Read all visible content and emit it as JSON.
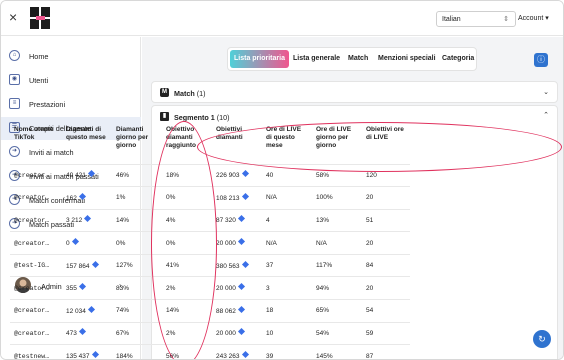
{
  "topbar": {
    "close_icon": "×",
    "language_value": "Italian",
    "account_label": "Account"
  },
  "sidebar": {
    "items": [
      {
        "label": "Home",
        "icon": "home-icon"
      },
      {
        "label": "Utenti",
        "icon": "users-icon"
      },
      {
        "label": "Prestazioni",
        "icon": "chart-icon"
      },
      {
        "label": "Compiti dell'agente",
        "icon": "tasks-icon"
      },
      {
        "label": "Inviti ai match",
        "icon": "invite-icon"
      },
      {
        "label": "Inviti ai match passati",
        "icon": "invite-past-icon"
      },
      {
        "label": "Match confermati",
        "icon": "confirmed-icon"
      },
      {
        "label": "Match passati",
        "icon": "past-match-icon"
      }
    ],
    "user_label": "Admin"
  },
  "tabs": [
    "Lista prioritaria",
    "Lista generale",
    "Match",
    "Menzioni speciali",
    "Categoria"
  ],
  "panels": {
    "match": {
      "title": "Match",
      "count": "(1)"
    },
    "segment": {
      "title": "Segmento 1",
      "count": "(10)"
    }
  },
  "table": {
    "headers": [
      "Nome utente TikTok",
      "Diamanti di questo mese",
      "Diamanti giorno per giorno",
      "Obiettivo diamanti raggiunto",
      "Obiettivi diamanti",
      "Ore di LIVE di questo mese",
      "Ore di LIVE giorno per giorno",
      "Obiettivi ore di LIVE"
    ],
    "rows": [
      [
        "@creator…",
        "40 421",
        "46%",
        "18%",
        "226 903",
        "40",
        "58%",
        "120"
      ],
      [
        "@creator…",
        "162",
        "1%",
        "0%",
        "108 213",
        "N/A",
        "100%",
        "20"
      ],
      [
        "@creator…",
        "3 212",
        "14%",
        "4%",
        "87 320",
        "4",
        "13%",
        "51"
      ],
      [
        "@creator…",
        "0",
        "0%",
        "0%",
        "20 000",
        "N/A",
        "N/A",
        "20"
      ],
      [
        "@test-IG…",
        "157 864",
        "127%",
        "41%",
        "380 563",
        "37",
        "117%",
        "84"
      ],
      [
        "@creator…",
        "355",
        "83%",
        "2%",
        "20 000",
        "3",
        "94%",
        "20"
      ],
      [
        "@creator…",
        "12 034",
        "74%",
        "14%",
        "88 062",
        "18",
        "65%",
        "54"
      ],
      [
        "@creator…",
        "473",
        "67%",
        "2%",
        "20 000",
        "10",
        "54%",
        "59"
      ],
      [
        "@testnew…",
        "135 437",
        "184%",
        "56%",
        "243 263",
        "39",
        "145%",
        "87"
      ]
    ]
  }
}
